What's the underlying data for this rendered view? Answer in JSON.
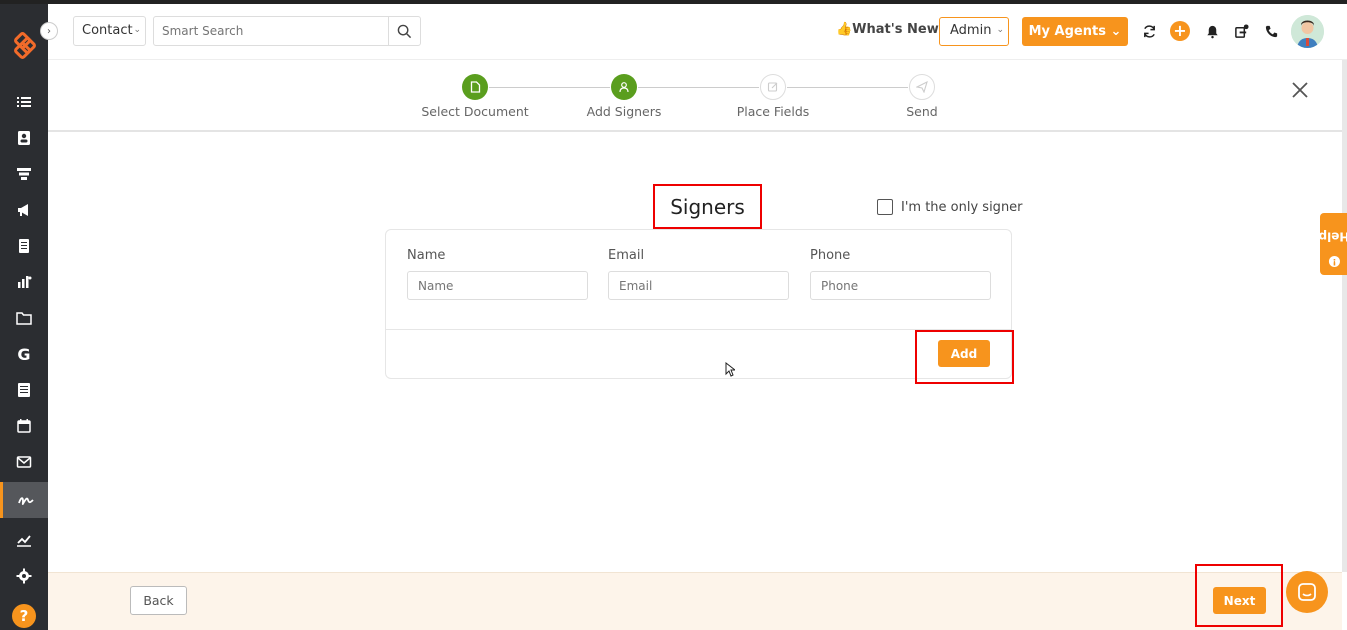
{
  "header": {
    "contact_label": "Contact",
    "search_placeholder": "Smart Search",
    "whats_new": "👍What's New",
    "admin_label": "Admin",
    "agents_label": "My Agents ⌄"
  },
  "stepper": {
    "steps": [
      {
        "label": "Select Document",
        "status": "done"
      },
      {
        "label": "Add Signers",
        "status": "done"
      },
      {
        "label": "Place Fields",
        "status": "todo"
      },
      {
        "label": "Send",
        "status": "todo"
      }
    ]
  },
  "signers": {
    "title": "Signers",
    "only_signer_label": "I'm the only signer",
    "name_label": "Name",
    "name_placeholder": "Name",
    "email_label": "Email",
    "email_placeholder": "Email",
    "phone_label": "Phone",
    "phone_placeholder": "Phone",
    "add_label": "Add"
  },
  "footer": {
    "back_label": "Back",
    "next_label": "Next"
  },
  "help_tab": {
    "label": "Help"
  },
  "colors": {
    "accent": "#f7941d",
    "sidebar": "#2b2d31",
    "step_done": "#5a9e1e",
    "highlight": "#e00000"
  }
}
